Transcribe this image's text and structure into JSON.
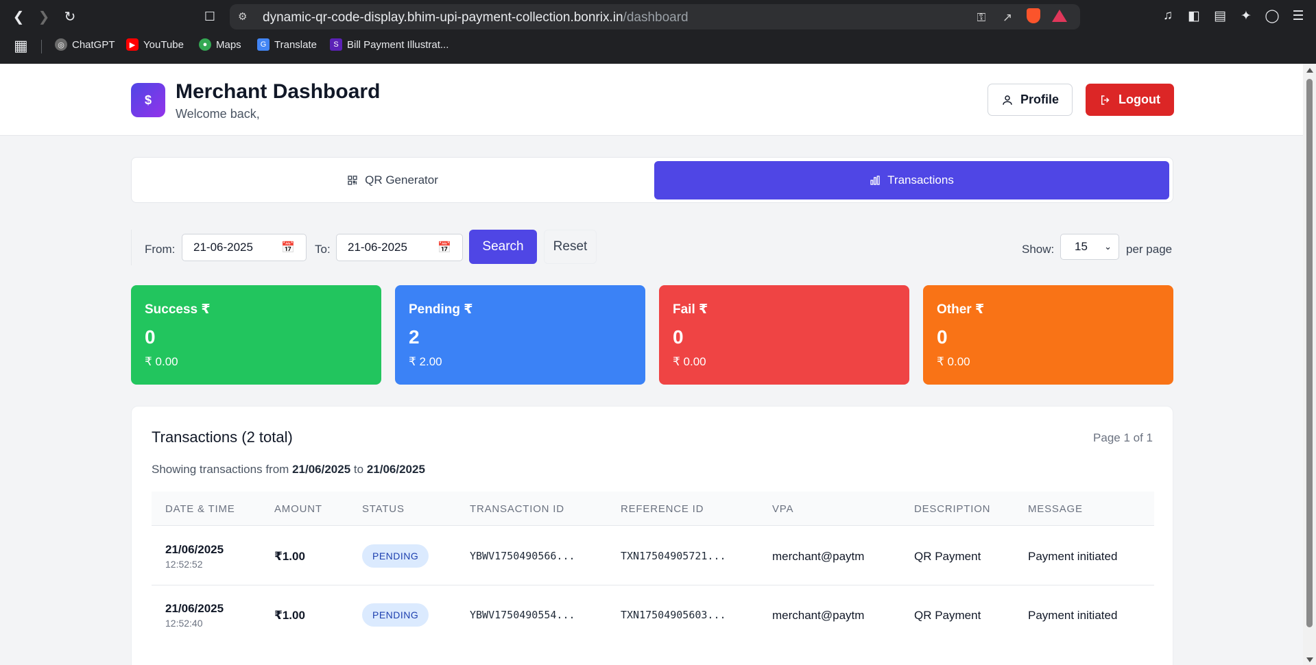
{
  "browser": {
    "url_host": "dynamic-qr-code-display.bhim-upi-payment-collection.bonrix.in",
    "url_path": "/dashboard",
    "bookmarks": [
      {
        "label": "ChatGPT",
        "color": "#6b6b6b",
        "glyph": "◎"
      },
      {
        "label": "YouTube",
        "color": "#ff0000",
        "glyph": "▶"
      },
      {
        "label": "Maps",
        "color": "#34a853",
        "glyph": "●"
      },
      {
        "label": "Translate",
        "color": "#4285f4",
        "glyph": "G"
      },
      {
        "label": "Bill Payment Illustrat...",
        "color": "#5b21b6",
        "glyph": "S"
      }
    ]
  },
  "header": {
    "logo_symbol": "$",
    "title": "Merchant Dashboard",
    "subtitle": "Welcome back,",
    "profile_label": "Profile",
    "logout_label": "Logout"
  },
  "tabs": [
    {
      "label": "QR Generator",
      "active": false
    },
    {
      "label": "Transactions",
      "active": true
    }
  ],
  "filters": {
    "from_label": "From:",
    "from_value": "21-06-2025",
    "to_label": "To:",
    "to_value": "21-06-2025",
    "search_label": "Search",
    "reset_label": "Reset",
    "show_label": "Show:",
    "per_page_value": "15",
    "per_page_label": "per page"
  },
  "summary": [
    {
      "label": "Success ₹",
      "count": "0",
      "amount": "₹ 0.00",
      "color": "#22c55e"
    },
    {
      "label": "Pending ₹",
      "count": "2",
      "amount": "₹ 2.00",
      "color": "#3b82f6"
    },
    {
      "label": "Fail ₹",
      "count": "0",
      "amount": "₹ 0.00",
      "color": "#ef4444"
    },
    {
      "label": "Other ₹",
      "count": "0",
      "amount": "₹ 0.00",
      "color": "#f97316"
    }
  ],
  "transactions": {
    "title": "Transactions (2 total)",
    "page_info": "Page 1 of 1",
    "range_prefix": "Showing transactions from",
    "range_from": "21/06/2025",
    "range_to_word": "to",
    "range_to": "21/06/2025",
    "columns": [
      "Date & Time",
      "Amount",
      "Status",
      "Transaction ID",
      "Reference ID",
      "VPA",
      "Description",
      "Message"
    ],
    "rows": [
      {
        "date": "21/06/2025",
        "time": "12:52:52",
        "amount": "₹1.00",
        "status": "PENDING",
        "txn_id": "YBWV1750490566...",
        "ref_id": "TXN17504905721...",
        "vpa": "merchant@paytm",
        "description": "QR Payment",
        "message": "Payment initiated"
      },
      {
        "date": "21/06/2025",
        "time": "12:52:40",
        "amount": "₹1.00",
        "status": "PENDING",
        "txn_id": "YBWV1750490554...",
        "ref_id": "TXN17504905603...",
        "vpa": "merchant@paytm",
        "description": "QR Payment",
        "message": "Payment initiated"
      }
    ]
  }
}
